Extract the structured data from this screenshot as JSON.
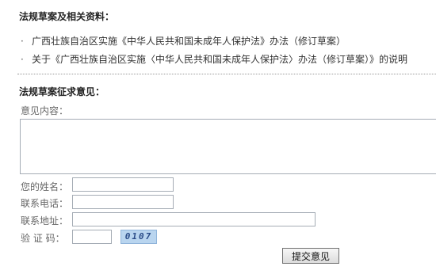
{
  "section1": {
    "title": "法规草案及相关资料：",
    "links": [
      {
        "bullet": "·",
        "text": "广西壮族自治区实施《中华人民共和国未成年人保护法》办法（修订草案）"
      },
      {
        "bullet": "·",
        "text": "关于《广西壮族自治区实施〈中华人民共和国未成年人保护法〉办法（修订草案）》的说明"
      }
    ]
  },
  "section2": {
    "title": "法规草案征求意见：",
    "content_label": "意见内容：",
    "name_label": "您的姓名：",
    "phone_label": "联系电话：",
    "address_label": "联系地址：",
    "captcha_label": "验 证 码：",
    "captcha_text": "0107",
    "submit_label": "提交意见"
  }
}
